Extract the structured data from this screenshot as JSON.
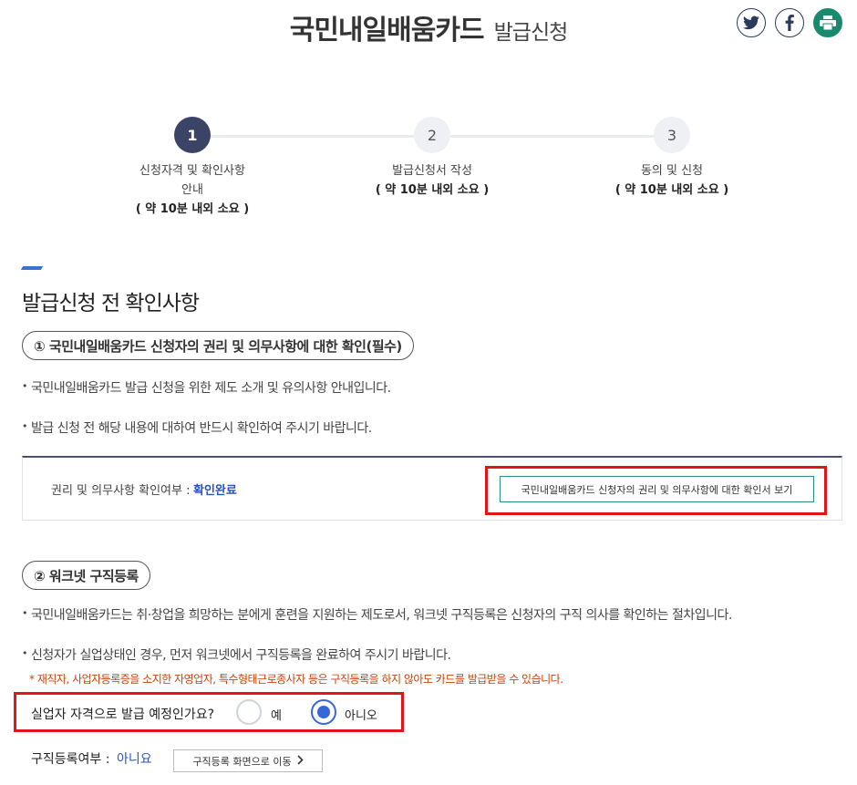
{
  "header": {
    "title_main": "국민내일배움카드",
    "title_sub": "발급신청",
    "share_icons": [
      "twitter-icon",
      "facebook-icon",
      "print-icon"
    ],
    "print_color": "#1a8a6e"
  },
  "steps": [
    {
      "number": "1",
      "label": "신청자격 및 확인사항",
      "label2": "안내",
      "duration": "( 약 10분 내외 소요 )",
      "active": true
    },
    {
      "number": "2",
      "label": "발급신청서 작성",
      "duration": "( 약 10분 내외 소요 )",
      "active": false
    },
    {
      "number": "3",
      "label": "동의 및 신청",
      "duration": "( 약 10분 내외 소요 )",
      "active": false
    }
  ],
  "section": {
    "title": "발급신청 전 확인사항"
  },
  "part1": {
    "heading": "① 국민내일배움카드 신청자의 권리 및 의무사항에 대한 확인(필수)",
    "bullets": [
      "국민내일배움카드 발급 신청을 위한 제도 소개 및 유의사항 안내입니다.",
      "발급 신청 전 해당 내용에 대하여 반드시 확인하여 주시기 바랍니다."
    ],
    "confirm_label": "권리 및 의무사항 확인여부 :",
    "confirm_value": "확인완료",
    "view_button": "국민내일배움카드 신청자의 권리 및 의무사항에 대한 확인서 보기"
  },
  "part2": {
    "heading": "② 워크넷 구직등록",
    "bullets": [
      "국민내일배움카드는 취·창업을 희망하는 분에게 훈련을 지원하는 제도로서, 워크넷 구직등록은 신청자의 구직 의사를 확인하는 절차입니다.",
      "신청자가 실업상태인 경우, 먼저 워크넷에서 구직등록을 완료하여 주시기 바랍니다."
    ],
    "note": "* 재직자, 사업자등록증을 소지한 자영업자, 특수형태근로종사자 등은 구직등록을 하지 않아도 카드를 발급받을 수 있습니다.",
    "question": "실업자 자격으로 발급 예정인가요?",
    "option_yes": "예",
    "option_no": "아니오",
    "selected": "아니오",
    "jobreg_label": "구직등록여부 :",
    "jobreg_value": "아니요",
    "goto_button": "구직등록 화면으로 이동"
  },
  "colors": {
    "accent": "#3a6fd6",
    "highlight_border": "#e3151c",
    "note_text": "#c8430c",
    "link_blue": "#2653c4"
  }
}
